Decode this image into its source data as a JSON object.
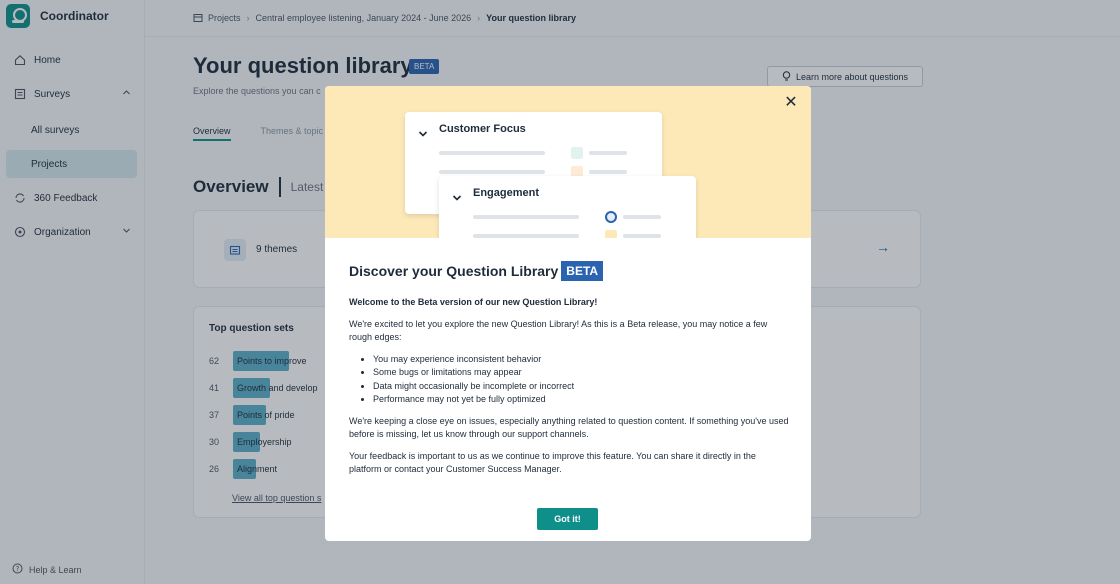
{
  "app": {
    "name": "Coordinator"
  },
  "sidebar": {
    "items": [
      {
        "label": "Home",
        "icon": "home-icon"
      },
      {
        "label": "Surveys",
        "icon": "surveys-icon"
      },
      {
        "label": "All surveys"
      },
      {
        "label": "Projects"
      },
      {
        "label": "360 Feedback",
        "icon": "refresh-icon"
      },
      {
        "label": "Organization",
        "icon": "org-icon"
      }
    ],
    "help_label": "Help & Learn"
  },
  "breadcrumb": {
    "items": [
      "Projects",
      "Central employee listening, January 2024 - June 2026",
      "Your question library"
    ]
  },
  "page": {
    "title": "Your question library",
    "beta": "BETA",
    "subtitle": "Explore the questions you can c",
    "learn_more": "Learn more about questions",
    "tabs": [
      "Overview",
      "Themes & topic"
    ],
    "overview_heading": "Overview",
    "latest": "Latest",
    "themes_count": "9 themes",
    "arrow": "→",
    "sets_title": "Top question sets",
    "sets": [
      {
        "count": "62",
        "label": "Points to improve",
        "fill": 0.62
      },
      {
        "count": "41",
        "label": "Growth and develop",
        "fill": 0.41
      },
      {
        "count": "37",
        "label": "Points of pride",
        "fill": 0.37
      },
      {
        "count": "30",
        "label": "Employership",
        "fill": 0.3
      },
      {
        "count": "26",
        "label": "Alignment",
        "fill": 0.26
      }
    ],
    "view_all": "View all top question s"
  },
  "modal": {
    "close": "✕",
    "hero": {
      "card1_title": "Customer Focus",
      "card2_title": "Engagement"
    },
    "title": "Discover your Question Library",
    "beta": "BETA",
    "lead": "Welcome to the Beta version of our new Question Library!",
    "intro": "We're excited to let you explore the new Question Library! As this is a Beta release, you may notice a few rough edges:",
    "bullets": [
      "You may experience inconsistent behavior",
      "Some bugs or limitations may appear",
      "Data might occasionally be incomplete or incorrect",
      "Performance may not yet be fully optimized"
    ],
    "para2": "We're keeping a close eye on issues, especially anything related to question content. If something you've used before is missing, let us know through our support channels.",
    "para3": "Your feedback is important to us as we continue to improve this feature. You can share it directly in the platform or contact your Customer Success Manager.",
    "button": "Got it!"
  },
  "colors": {
    "accent": "#0f8f8a",
    "beta": "#2a63b0",
    "hero": "#fde9b8",
    "bar": "#5cb0c7"
  }
}
